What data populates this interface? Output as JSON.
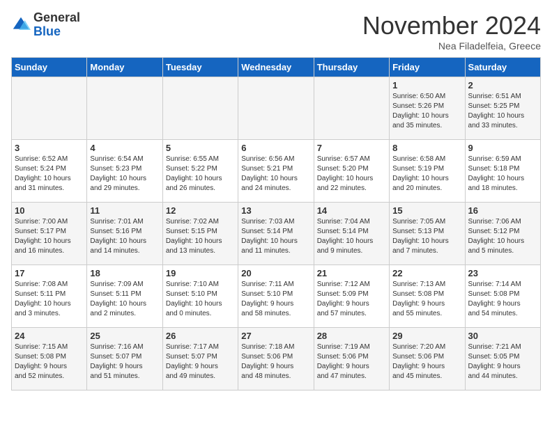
{
  "logo": {
    "general": "General",
    "blue": "Blue"
  },
  "header": {
    "month": "November 2024",
    "location": "Nea Filadelfeia, Greece"
  },
  "days_of_week": [
    "Sunday",
    "Monday",
    "Tuesday",
    "Wednesday",
    "Thursday",
    "Friday",
    "Saturday"
  ],
  "weeks": [
    [
      {
        "day": "",
        "info": ""
      },
      {
        "day": "",
        "info": ""
      },
      {
        "day": "",
        "info": ""
      },
      {
        "day": "",
        "info": ""
      },
      {
        "day": "",
        "info": ""
      },
      {
        "day": "1",
        "info": "Sunrise: 6:50 AM\nSunset: 5:26 PM\nDaylight: 10 hours\nand 35 minutes."
      },
      {
        "day": "2",
        "info": "Sunrise: 6:51 AM\nSunset: 5:25 PM\nDaylight: 10 hours\nand 33 minutes."
      }
    ],
    [
      {
        "day": "3",
        "info": "Sunrise: 6:52 AM\nSunset: 5:24 PM\nDaylight: 10 hours\nand 31 minutes."
      },
      {
        "day": "4",
        "info": "Sunrise: 6:54 AM\nSunset: 5:23 PM\nDaylight: 10 hours\nand 29 minutes."
      },
      {
        "day": "5",
        "info": "Sunrise: 6:55 AM\nSunset: 5:22 PM\nDaylight: 10 hours\nand 26 minutes."
      },
      {
        "day": "6",
        "info": "Sunrise: 6:56 AM\nSunset: 5:21 PM\nDaylight: 10 hours\nand 24 minutes."
      },
      {
        "day": "7",
        "info": "Sunrise: 6:57 AM\nSunset: 5:20 PM\nDaylight: 10 hours\nand 22 minutes."
      },
      {
        "day": "8",
        "info": "Sunrise: 6:58 AM\nSunset: 5:19 PM\nDaylight: 10 hours\nand 20 minutes."
      },
      {
        "day": "9",
        "info": "Sunrise: 6:59 AM\nSunset: 5:18 PM\nDaylight: 10 hours\nand 18 minutes."
      }
    ],
    [
      {
        "day": "10",
        "info": "Sunrise: 7:00 AM\nSunset: 5:17 PM\nDaylight: 10 hours\nand 16 minutes."
      },
      {
        "day": "11",
        "info": "Sunrise: 7:01 AM\nSunset: 5:16 PM\nDaylight: 10 hours\nand 14 minutes."
      },
      {
        "day": "12",
        "info": "Sunrise: 7:02 AM\nSunset: 5:15 PM\nDaylight: 10 hours\nand 13 minutes."
      },
      {
        "day": "13",
        "info": "Sunrise: 7:03 AM\nSunset: 5:14 PM\nDaylight: 10 hours\nand 11 minutes."
      },
      {
        "day": "14",
        "info": "Sunrise: 7:04 AM\nSunset: 5:14 PM\nDaylight: 10 hours\nand 9 minutes."
      },
      {
        "day": "15",
        "info": "Sunrise: 7:05 AM\nSunset: 5:13 PM\nDaylight: 10 hours\nand 7 minutes."
      },
      {
        "day": "16",
        "info": "Sunrise: 7:06 AM\nSunset: 5:12 PM\nDaylight: 10 hours\nand 5 minutes."
      }
    ],
    [
      {
        "day": "17",
        "info": "Sunrise: 7:08 AM\nSunset: 5:11 PM\nDaylight: 10 hours\nand 3 minutes."
      },
      {
        "day": "18",
        "info": "Sunrise: 7:09 AM\nSunset: 5:11 PM\nDaylight: 10 hours\nand 2 minutes."
      },
      {
        "day": "19",
        "info": "Sunrise: 7:10 AM\nSunset: 5:10 PM\nDaylight: 10 hours\nand 0 minutes."
      },
      {
        "day": "20",
        "info": "Sunrise: 7:11 AM\nSunset: 5:10 PM\nDaylight: 9 hours\nand 58 minutes."
      },
      {
        "day": "21",
        "info": "Sunrise: 7:12 AM\nSunset: 5:09 PM\nDaylight: 9 hours\nand 57 minutes."
      },
      {
        "day": "22",
        "info": "Sunrise: 7:13 AM\nSunset: 5:08 PM\nDaylight: 9 hours\nand 55 minutes."
      },
      {
        "day": "23",
        "info": "Sunrise: 7:14 AM\nSunset: 5:08 PM\nDaylight: 9 hours\nand 54 minutes."
      }
    ],
    [
      {
        "day": "24",
        "info": "Sunrise: 7:15 AM\nSunset: 5:08 PM\nDaylight: 9 hours\nand 52 minutes."
      },
      {
        "day": "25",
        "info": "Sunrise: 7:16 AM\nSunset: 5:07 PM\nDaylight: 9 hours\nand 51 minutes."
      },
      {
        "day": "26",
        "info": "Sunrise: 7:17 AM\nSunset: 5:07 PM\nDaylight: 9 hours\nand 49 minutes."
      },
      {
        "day": "27",
        "info": "Sunrise: 7:18 AM\nSunset: 5:06 PM\nDaylight: 9 hours\nand 48 minutes."
      },
      {
        "day": "28",
        "info": "Sunrise: 7:19 AM\nSunset: 5:06 PM\nDaylight: 9 hours\nand 47 minutes."
      },
      {
        "day": "29",
        "info": "Sunrise: 7:20 AM\nSunset: 5:06 PM\nDaylight: 9 hours\nand 45 minutes."
      },
      {
        "day": "30",
        "info": "Sunrise: 7:21 AM\nSunset: 5:05 PM\nDaylight: 9 hours\nand 44 minutes."
      }
    ]
  ]
}
